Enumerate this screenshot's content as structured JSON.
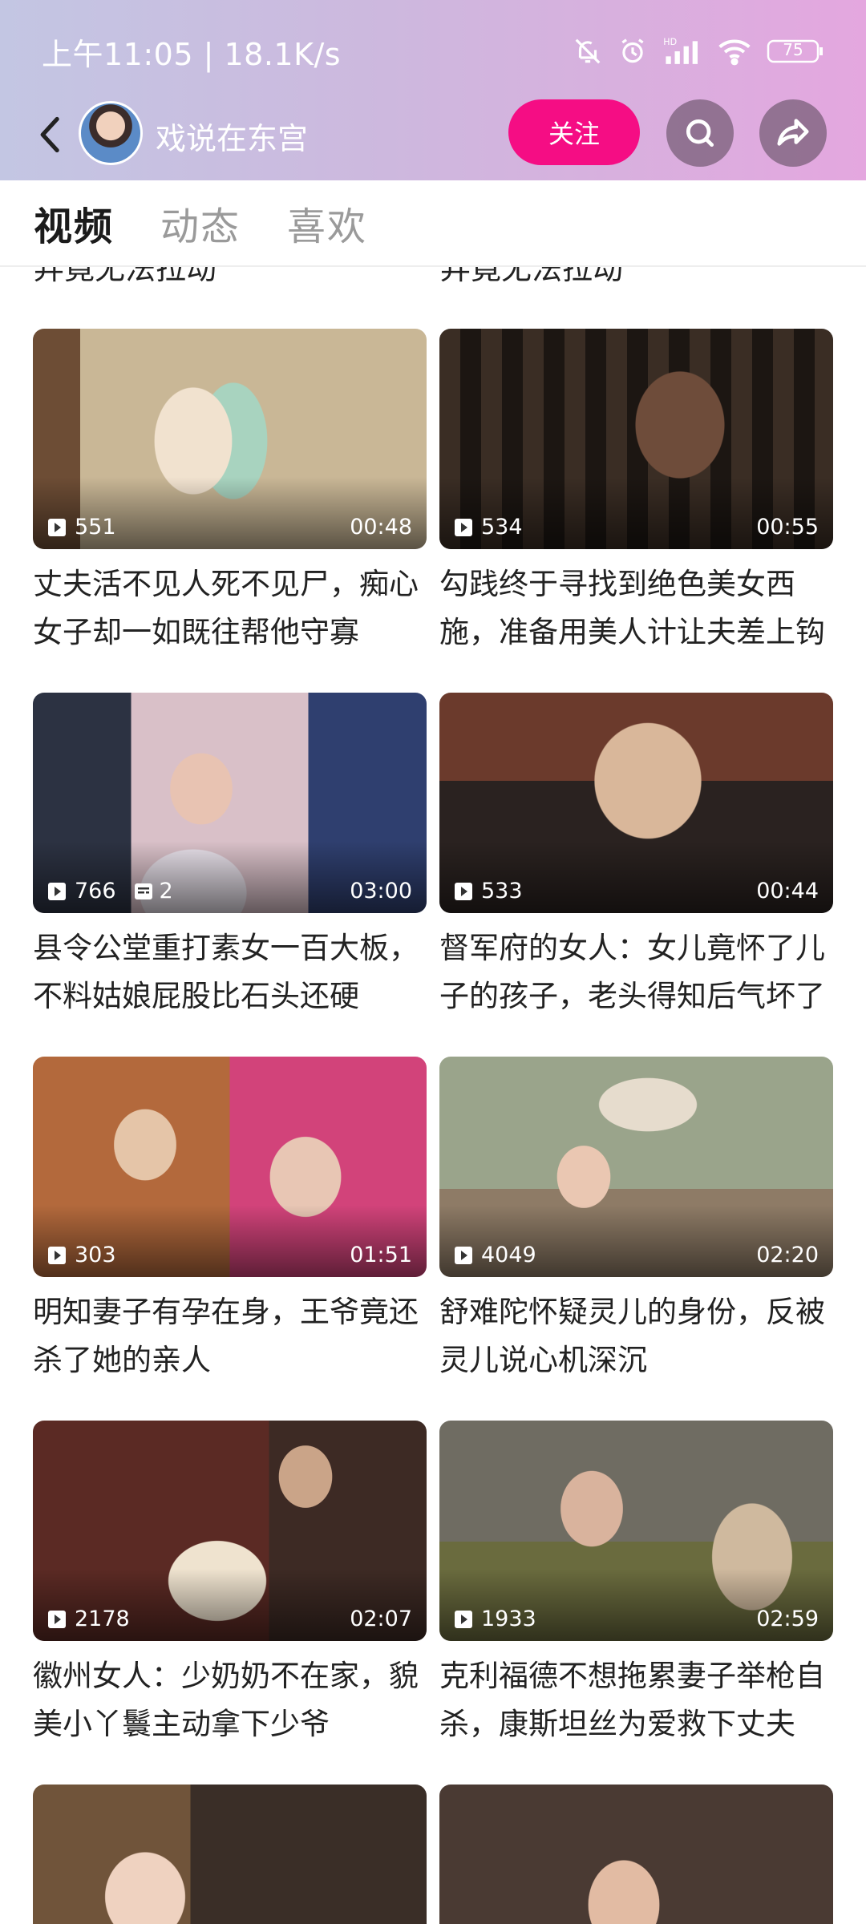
{
  "status_bar": {
    "time_speed": "上午11:05 | 18.1K/s",
    "battery": "75"
  },
  "header": {
    "channel_name": "戏说在东宫",
    "follow_label": "关注"
  },
  "tabs": [
    {
      "label": "视频",
      "active": true
    },
    {
      "label": "动态",
      "active": false
    },
    {
      "label": "喜欢",
      "active": false
    }
  ],
  "cut_titles": {
    "left": "弄竟无法拉动",
    "right": "弄竟无法拉动"
  },
  "videos": [
    {
      "views": "551",
      "duration": "00:48",
      "title": "丈夫活不见人死不见尸，痴心女子却一如既往帮他守寡"
    },
    {
      "views": "534",
      "duration": "00:55",
      "title": "勾践终于寻找到绝色美女西施，准备用美人计让夫差上钩"
    },
    {
      "views": "766",
      "danmaku": "2",
      "duration": "03:00",
      "title": "县令公堂重打素女一百大板，不料姑娘屁股比石头还硬"
    },
    {
      "views": "533",
      "duration": "00:44",
      "title": "督军府的女人：女儿竟怀了儿子的孩子，老头得知后气坏了"
    },
    {
      "views": "303",
      "duration": "01:51",
      "title": "明知妻子有孕在身，王爷竟还杀了她的亲人"
    },
    {
      "views": "4049",
      "duration": "02:20",
      "title": "舒难陀怀疑灵儿的身份，反被灵儿说心机深沉"
    },
    {
      "views": "2178",
      "duration": "02:07",
      "title": "徽州女人：少奶奶不在家，貌美小丫鬟主动拿下少爷"
    },
    {
      "views": "1933",
      "duration": "02:59",
      "title": "克利福德不想拖累妻子举枪自杀，康斯坦丝为爱救下丈夫"
    }
  ]
}
